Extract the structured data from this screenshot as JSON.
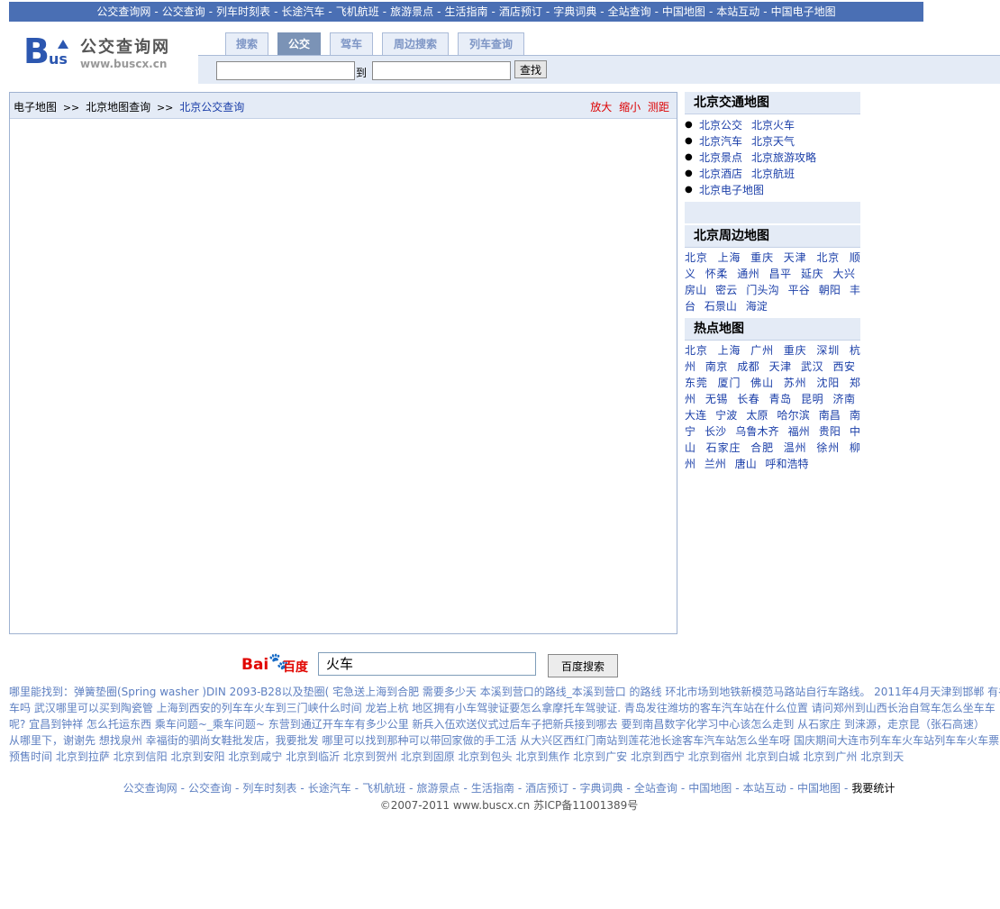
{
  "top_nav": [
    "公交查询网",
    "公交查询",
    "列车时刻表",
    "长途汽车",
    "飞机航班",
    "旅游景点",
    "生活指南",
    "酒店预订",
    "字典词典",
    "全站查询",
    "中国地图",
    "本站互动",
    "中国电子地图"
  ],
  "logo": {
    "name": "公交查询网",
    "url": "www.buscx.cn",
    "b": "B",
    "u": "us"
  },
  "tabs": [
    "搜索",
    "公交",
    "驾车",
    "周边搜索",
    "列车查询"
  ],
  "search": {
    "to_label": "到",
    "button": "查找",
    "from_value": "",
    "to_value": ""
  },
  "breadcrumb": {
    "root": "电子地图",
    "arrow": ">>",
    "level2": "北京地图查询",
    "level3": "北京公交查询"
  },
  "map_tools": [
    "放大",
    "缩小",
    "测距"
  ],
  "sidebar": {
    "traffic_title": "北京交通地图",
    "traffic_rows": [
      [
        "北京公交",
        "北京火车"
      ],
      [
        "北京汽车",
        "北京天气"
      ],
      [
        "北京景点",
        "北京旅游攻略"
      ],
      [
        "北京酒店",
        "北京航班"
      ],
      [
        "北京电子地图"
      ]
    ],
    "nearby_title": "北京周边地图",
    "nearby": [
      "北京",
      "上海",
      "重庆",
      "天津",
      "北京",
      "顺义",
      "怀柔",
      "通州",
      "昌平",
      "延庆",
      "大兴",
      "房山",
      "密云",
      "门头沟",
      "平谷",
      "朝阳",
      "丰台",
      "石景山",
      "海淀"
    ],
    "hot_title": "热点地图",
    "hot": [
      "北京",
      "上海",
      "广州",
      "重庆",
      "深圳",
      "杭州",
      "南京",
      "成都",
      "天津",
      "武汉",
      "西安",
      "东莞",
      "厦门",
      "佛山",
      "苏州",
      "沈阳",
      "郑州",
      "无锡",
      "长春",
      "青岛",
      "昆明",
      "济南",
      "大连",
      "宁波",
      "太原",
      "哈尔滨",
      "南昌",
      "南宁",
      "长沙",
      "乌鲁木齐",
      "福州",
      "贵阳",
      "中山",
      "石家庄",
      "合肥",
      "温州",
      "徐州",
      "柳州",
      "兰州",
      "唐山",
      "呼和浩特"
    ]
  },
  "baidu": {
    "bai": "Bai",
    "du": "百度",
    "query": "火车",
    "button": "百度搜索"
  },
  "keywords": [
    "哪里能找到：弹簧垫圈(Spring washer )DIN 2093-B28以及垫圈( 宅急送上海到合肥  需要多少天  本溪到营口的路线_本溪到营口  的路线  环北市场到地铁新模范马路站自行车路线。  2011年4月天津到邯郸  有谷",
    "车吗  武汉哪里可以买到陶瓷管  上海到西安的列车车火车到三门峡什么时间  龙岩上杭  地区拥有小车驾驶证要怎么拿摩托车驾驶证. 青岛发往潍坊的客车汽车站在什么位置  请问郑州到山西长治自驾车怎么坐车车",
    "呢? 宜昌到钟祥  怎么托运东西  乘车问题~_乘车问题~  东营到通辽开车车有多少公里  新兵入伍欢送仪式过后车子把新兵接到哪去  要到南昌数字化学习中心该怎么走到  从石家庄  到涞源，走京昆（张石高速）",
    "从哪里下，谢谢先  想找泉州  幸福街的驷尚女鞋批发店，我要批发  哪里可以找到那种可以带回家做的手工活  从大兴区西红门南站到莲花池长途客车汽车站怎么坐车呀  国庆期间大连市列车车火车站列车车火车票",
    "预售时间  北京到拉萨   北京到信阳   北京到安阳   北京到咸宁   北京到临沂   北京到贺州   北京到固原   北京到包头   北京到焦作   北京到广安   北京到西宁   北京到宿州   北京到白城   北京到广州   北京到天"
  ],
  "footer_nav": [
    "公交查询网",
    "公交查询",
    "列车时刻表",
    "长途汽车",
    "飞机航班",
    "旅游景点",
    "生活指南",
    "酒店预订",
    "字典词典",
    "全站查询",
    "中国地图",
    "本站互动",
    "中国地图"
  ],
  "footer_stat": "我要统计",
  "copyright": "©2007-2011 www.buscx.cn   苏ICP备11001389号"
}
